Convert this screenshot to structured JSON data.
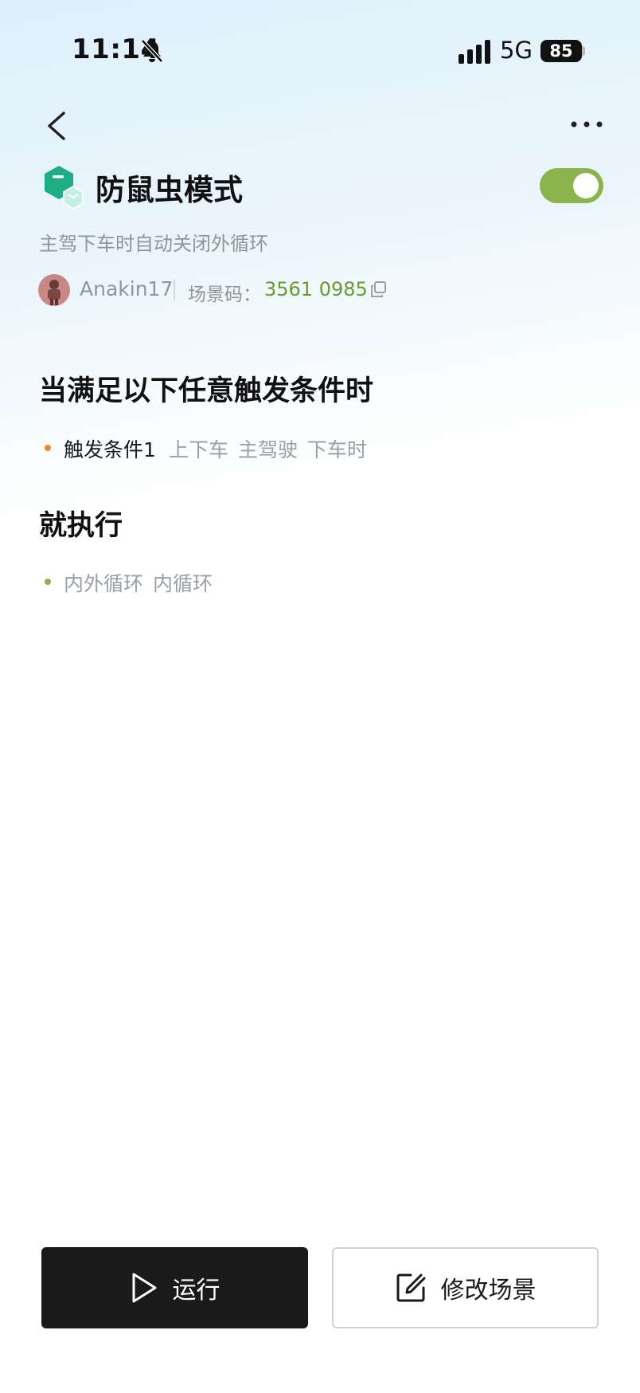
{
  "status_bar": {
    "time": "11:14",
    "network": "5G",
    "battery": "85"
  },
  "icons": {
    "back": "back-arrow-icon",
    "more": "more-icon",
    "bell": "bell-muted-icon",
    "copy": "copy-icon",
    "run": "play-icon",
    "edit": "edit-icon"
  },
  "scene": {
    "title": "防鼠虫模式",
    "enabled": true,
    "description": "主驾下车时自动关闭外循环",
    "author": "Anakin17",
    "code_label": "场景码：",
    "code_value": "3561 0985"
  },
  "trigger_section": {
    "heading": "当满足以下任意触发条件时",
    "items": [
      {
        "name": "触发条件1",
        "detail": "上下车 主驾驶 下车时"
      }
    ]
  },
  "action_section": {
    "heading": "就执行",
    "items": [
      {
        "detail": "内外循环 内循环"
      }
    ]
  },
  "buttons": {
    "run_label": "运行",
    "edit_label": "修改场景"
  },
  "colors": {
    "accent_green": "#8bb54c",
    "code_green": "#6b9a2c",
    "trigger_dot": "#f08a24",
    "run_button": "#1a1a1a"
  }
}
